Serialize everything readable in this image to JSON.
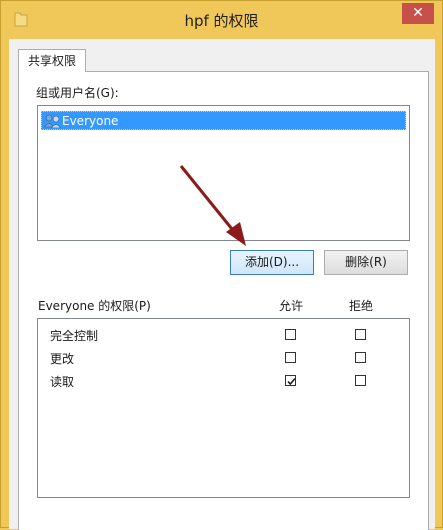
{
  "window": {
    "title": "hpf 的权限",
    "close_label": "✕"
  },
  "tabs": [
    {
      "label": "共享权限"
    }
  ],
  "group_section": {
    "label": "组或用户名(G):",
    "users": [
      {
        "name": "Everyone",
        "selected": true,
        "icon": "users-icon"
      }
    ]
  },
  "buttons": {
    "add_label": "添加(D)...",
    "remove_label": "删除(R)"
  },
  "permissions": {
    "header_label": "Everyone 的权限(P)",
    "allow_label": "允许",
    "deny_label": "拒绝",
    "rows": [
      {
        "name": "完全控制",
        "allow": false,
        "deny": false
      },
      {
        "name": "更改",
        "allow": false,
        "deny": false
      },
      {
        "name": "读取",
        "allow": true,
        "deny": false
      }
    ]
  },
  "colors": {
    "frame": "#f0c85a",
    "selection": "#3399ff",
    "close_button": "#c7504b",
    "annotation_arrow": "#8b1a1a"
  }
}
